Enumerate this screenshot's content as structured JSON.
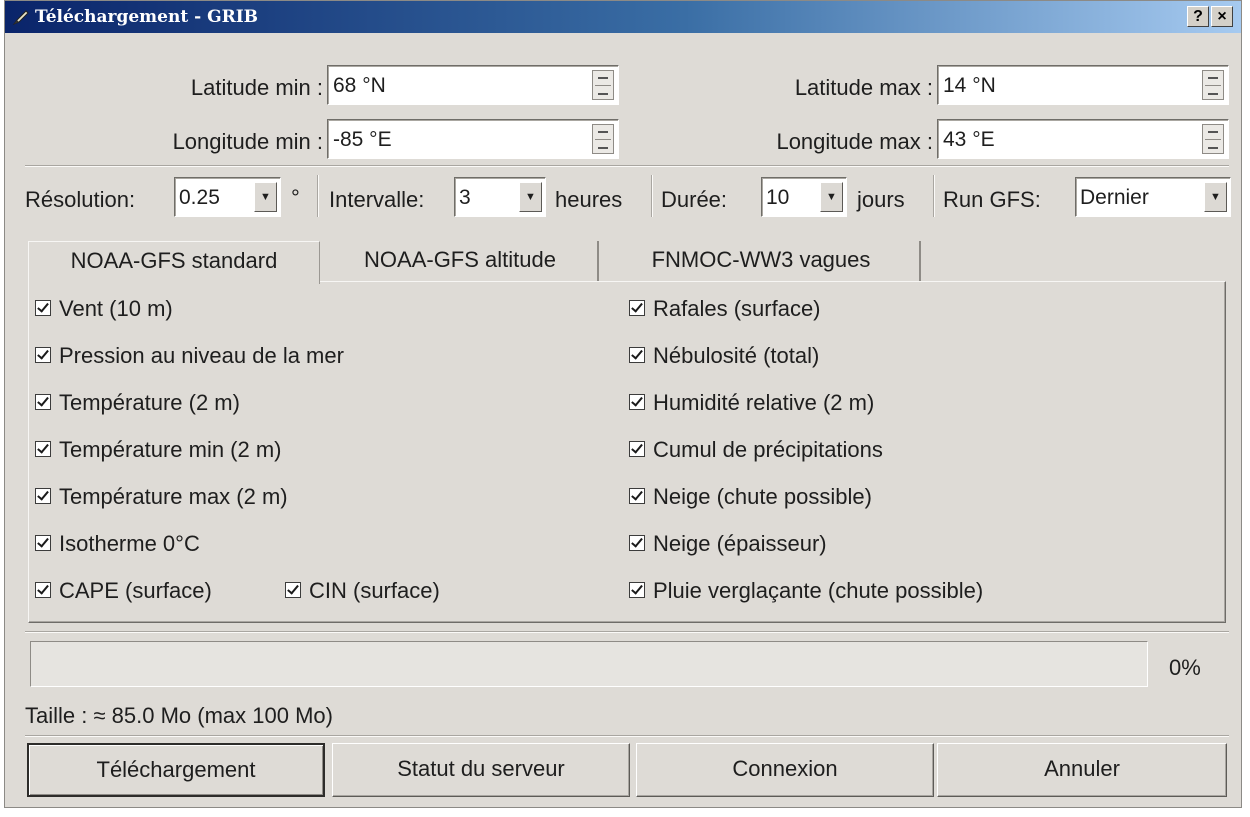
{
  "window": {
    "title": "Téléchargement - GRIB",
    "help_button": "?",
    "close_button": "×"
  },
  "coords": {
    "lat_min_label": "Latitude min :",
    "lat_min_value": "68 °N",
    "lat_max_label": "Latitude max :",
    "lat_max_value": "14 °N",
    "lon_min_label": "Longitude min :",
    "lon_min_value": "-85 °E",
    "lon_max_label": "Longitude max :",
    "lon_max_value": "43 °E"
  },
  "options": {
    "resolution_label": "Résolution:",
    "resolution_value": "0.25",
    "resolution_unit": "°",
    "interval_label": "Intervalle:",
    "interval_value": "3",
    "interval_unit": "heures",
    "duration_label": "Durée:",
    "duration_value": "10",
    "duration_unit": "jours",
    "run_label": "Run GFS:",
    "run_value": "Dernier"
  },
  "tabs": [
    {
      "label": "NOAA-GFS standard",
      "active": true
    },
    {
      "label": "NOAA-GFS altitude",
      "active": false
    },
    {
      "label": "FNMOC-WW3 vagues",
      "active": false
    }
  ],
  "params_left": [
    {
      "label": "Vent (10 m)",
      "checked": true
    },
    {
      "label": "Pression au niveau de la mer",
      "checked": true
    },
    {
      "label": "Température (2 m)",
      "checked": true
    },
    {
      "label": "Température min (2 m)",
      "checked": true
    },
    {
      "label": "Température max (2 m)",
      "checked": true
    },
    {
      "label": "Isotherme 0°C",
      "checked": true
    },
    {
      "label": "CAPE (surface)",
      "checked": true
    },
    {
      "label": "CIN (surface)",
      "checked": true
    }
  ],
  "params_right": [
    {
      "label": "Rafales (surface)",
      "checked": true
    },
    {
      "label": "Nébulosité (total)",
      "checked": true
    },
    {
      "label": "Humidité relative (2 m)",
      "checked": true
    },
    {
      "label": "Cumul de précipitations",
      "checked": true
    },
    {
      "label": "Neige (chute possible)",
      "checked": true
    },
    {
      "label": "Neige (épaisseur)",
      "checked": true
    },
    {
      "label": "Pluie verglaçante (chute possible)",
      "checked": true
    }
  ],
  "progress": {
    "fraction": 0,
    "text": "0%"
  },
  "size_text": "Taille : ≈ 85.0 Mo (max 100 Mo)",
  "buttons": {
    "download": "Téléchargement",
    "server_status": "Statut du serveur",
    "connection": "Connexion",
    "cancel": "Annuler"
  },
  "colors": {
    "titlebar_start": "#0a246a",
    "titlebar_end": "#a6caf0",
    "dialog_bg": "#dedbd6",
    "progress_fill": "#3a6ea5"
  }
}
